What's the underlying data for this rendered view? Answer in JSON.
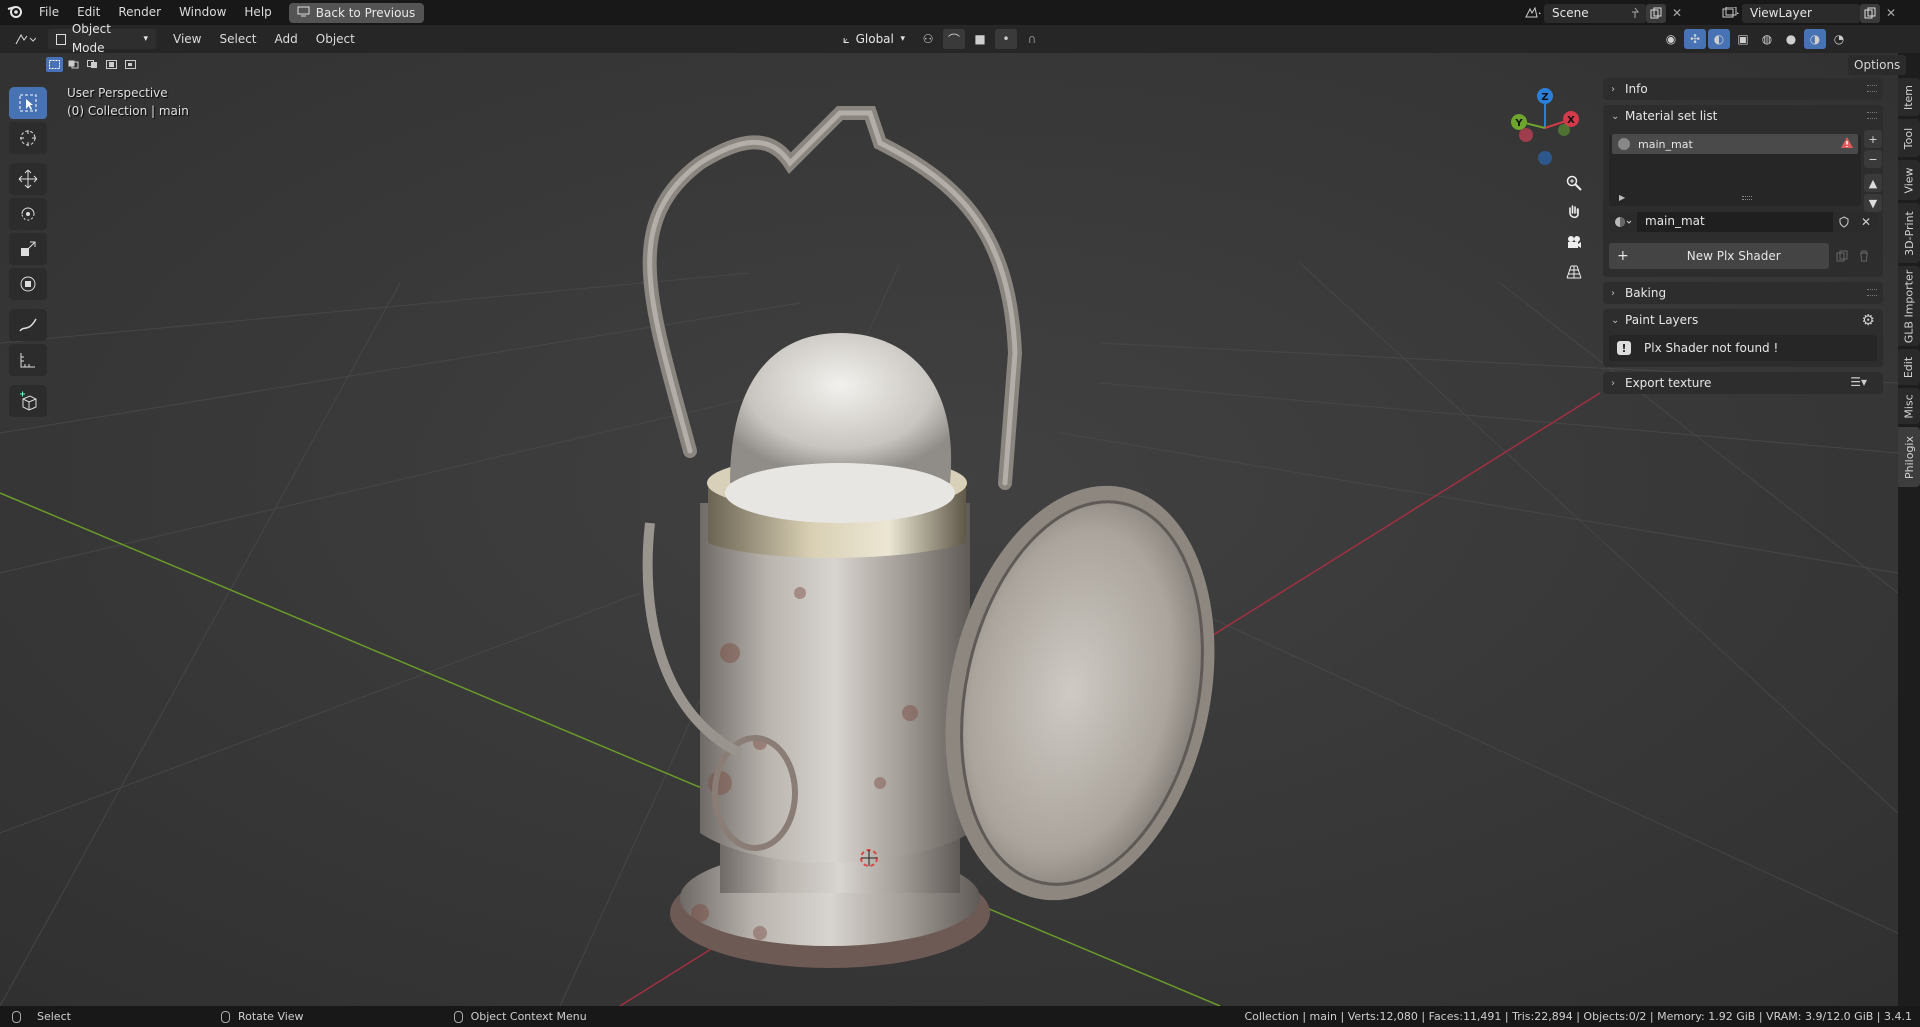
{
  "topbar": {
    "menus": [
      "File",
      "Edit",
      "Render",
      "Window",
      "Help"
    ],
    "back_button": "Back to Previous",
    "scene": "Scene",
    "view_layer": "ViewLayer"
  },
  "header": {
    "mode": "Object Mode",
    "menus": [
      "View",
      "Select",
      "Add",
      "Object"
    ],
    "transform_orientation": "Global",
    "options": "Options"
  },
  "viewport": {
    "perspective": "User Perspective",
    "collection": "(0) Collection | main",
    "gizmo_axes": [
      "X",
      "Y",
      "Z"
    ]
  },
  "npanel": {
    "info": "Info",
    "material_set_list": "Material set list",
    "material_item": "main_mat",
    "material_field": "main_mat",
    "new_shader_button": "New Plx Shader",
    "baking": "Baking",
    "paint_layers": "Paint Layers",
    "warning": "Plx Shader not found !",
    "export_texture": "Export texture"
  },
  "vtabs": [
    "Item",
    "Tool",
    "View",
    "3D-Print",
    "GLB Importer",
    "Edit",
    "Misc",
    "Philogix"
  ],
  "statusbar": {
    "select": "Select",
    "rotate": "Rotate View",
    "context": "Object Context Menu",
    "stats": "Collection | main | Verts:12,080 | Faces:11,491 | Tris:22,894 | Objects:0/2 | Memory: 1.92 GiB | VRAM: 3.9/12.0 GiB | 3.4.1"
  },
  "colors": {
    "accent": "#4772b3",
    "x_axis": "#d33a4a",
    "y_axis": "#6ea52e",
    "z_axis": "#2a7fd8",
    "warning": "#e05b5b"
  }
}
